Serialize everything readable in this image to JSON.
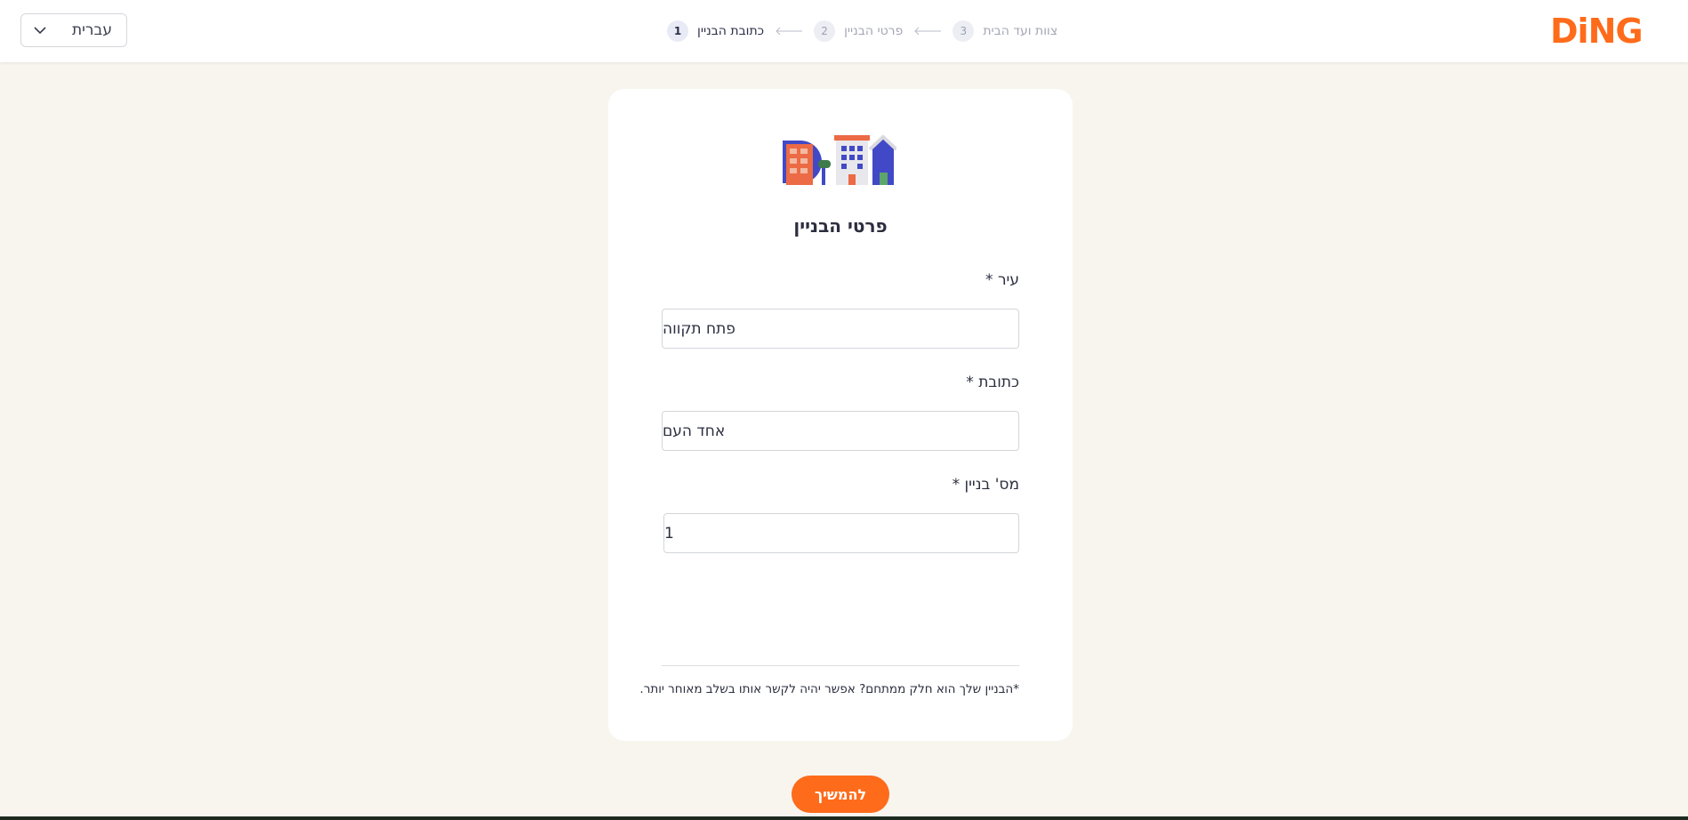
{
  "header": {
    "logo_text": "DiNG",
    "language": {
      "selected": "עברית"
    },
    "steps": [
      {
        "number": "1",
        "label": "כתובת הבניין",
        "active": true
      },
      {
        "number": "2",
        "label": "פרטי הבניין",
        "active": false
      },
      {
        "number": "3",
        "label": "צוות ועד הבית",
        "active": false
      }
    ]
  },
  "form": {
    "title": "פרטי הבניין",
    "city": {
      "label": "עיר *",
      "value": "פתח תקווה"
    },
    "address": {
      "label": "כתובת *",
      "value": "אחד העם"
    },
    "building_number": {
      "label": "מס' בניין *",
      "value": "1"
    },
    "note": "*הבניין שלך הוא חלק ממתחם? אפשר יהיה לקשר אותו בשלב מאוחר יותר."
  },
  "actions": {
    "continue_label": "להמשיך"
  },
  "colors": {
    "accent": "#fe6b1b",
    "background": "#f8f5ef",
    "text": "#2b2e3e"
  }
}
